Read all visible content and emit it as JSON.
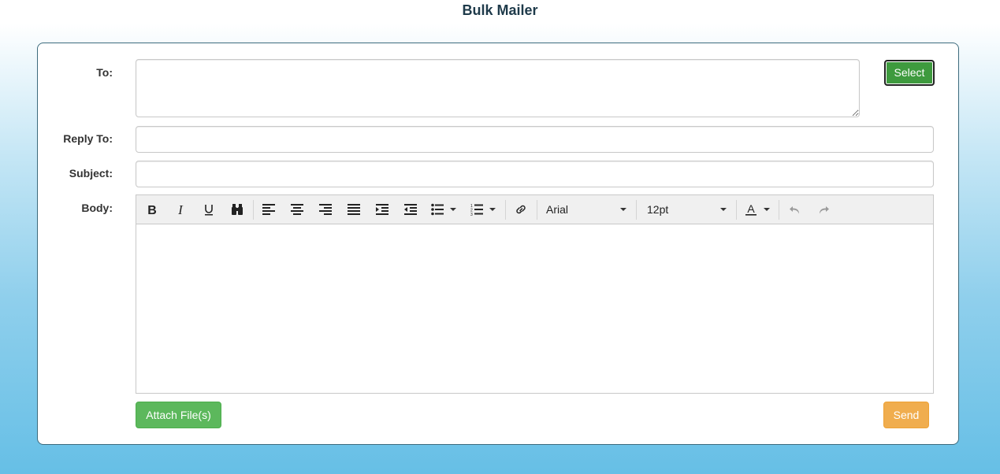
{
  "page": {
    "title": "Bulk Mailer"
  },
  "form": {
    "to_label": "To:",
    "to_value": "",
    "select_label": "Select",
    "reply_to_label": "Reply To:",
    "reply_to_value": "",
    "subject_label": "Subject:",
    "subject_value": "",
    "body_label": "Body:"
  },
  "editor": {
    "toolbar": {
      "buttons": [
        "bold-icon",
        "italic-icon",
        "underline-icon",
        "find-replace-icon",
        "align-left-icon",
        "align-center-icon",
        "align-right-icon",
        "align-justify-icon",
        "indent-icon",
        "outdent-icon",
        "bullet-list-icon",
        "numbered-list-icon",
        "link-icon",
        "text-color-icon",
        "undo-icon",
        "redo-icon"
      ],
      "font_family": "Arial",
      "font_size": "12pt"
    },
    "content": ""
  },
  "actions": {
    "attach_label": "Attach File(s)",
    "send_label": "Send"
  },
  "colors": {
    "select_button": "#3e9a3e",
    "attach_button": "#5cb85c",
    "send_button": "#f0ad4e",
    "title_text": "#1e3a4a",
    "panel_border": "#3d6b7d"
  }
}
